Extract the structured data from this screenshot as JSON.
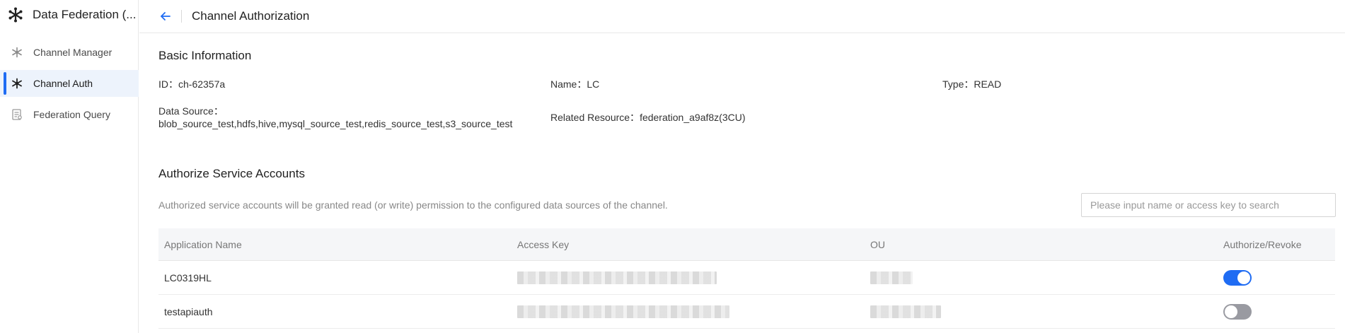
{
  "app": {
    "title": "Data Federation (..."
  },
  "sidebar": {
    "items": [
      {
        "label": "Channel Manager",
        "icon": "channel-manager-icon",
        "active": false
      },
      {
        "label": "Channel Auth",
        "icon": "channel-auth-icon",
        "active": true
      },
      {
        "label": "Federation Query",
        "icon": "federation-query-icon",
        "active": false
      }
    ]
  },
  "header": {
    "title": "Channel Authorization",
    "back_icon": "arrow-left-icon"
  },
  "basic_info": {
    "title": "Basic Information",
    "id_label": "ID：",
    "id_value": "ch-62357a",
    "name_label": "Name：",
    "name_value": "LC",
    "type_label": "Type：",
    "type_value": "READ",
    "data_source_label": "Data Source：",
    "data_source_value": "blob_source_test,hdfs,hive,mysql_source_test,redis_source_test,s3_source_test",
    "related_resource_label": "Related Resource：",
    "related_resource_value": "federation_a9af8z(3CU)"
  },
  "authorize": {
    "title": "Authorize Service Accounts",
    "description": "Authorized service accounts will be granted read (or write) permission to the configured data sources of the channel.",
    "search_placeholder": "Please input name or access key to search",
    "search_value": ""
  },
  "table": {
    "columns": [
      "Application Name",
      "Access Key",
      "OU",
      "Authorize/Revoke"
    ],
    "rows": [
      {
        "application_name": "LC0319HL",
        "access_key": "",
        "ou": "",
        "authorized": true
      },
      {
        "application_name": "testapiauth",
        "access_key": "",
        "ou": "",
        "authorized": false
      }
    ]
  },
  "colors": {
    "accent": "#1f6cf3",
    "toggle_off": "#999aa1",
    "header_bg": "#f5f6f8",
    "active_nav_bg": "#edf3fc"
  }
}
